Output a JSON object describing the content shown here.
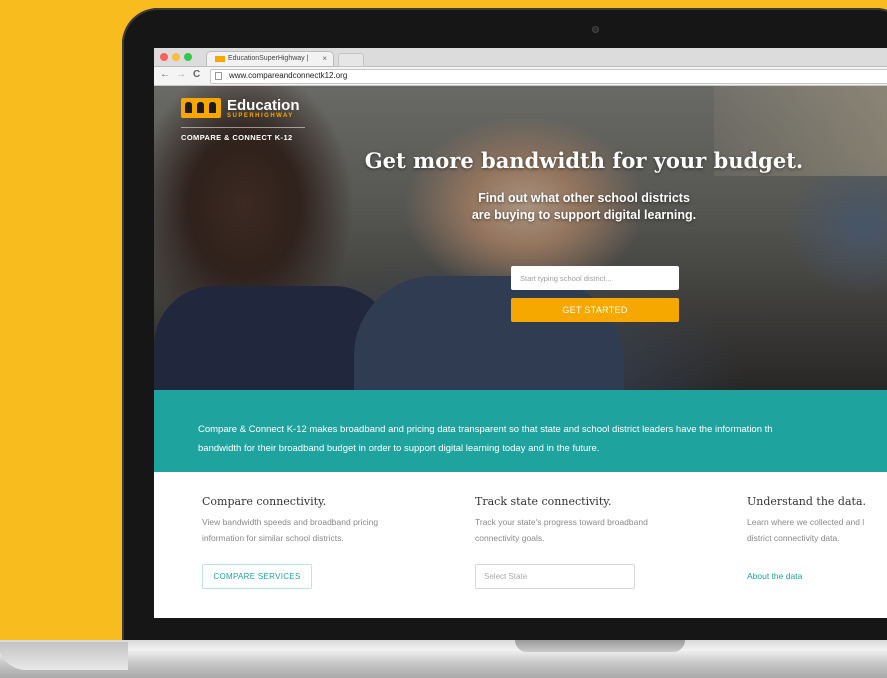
{
  "browser": {
    "tab_title": "EducationSuperHighway |",
    "tab_close": "×",
    "back": "←",
    "forward": "→",
    "reload": "C",
    "url": "www.compareandconnectk12.org"
  },
  "hero": {
    "logo_text": "Education",
    "logo_sub": "SUPERHIGHWAY",
    "product_name": "COMPARE & CONNECT K-12",
    "headline": "Get more bandwidth for your budget.",
    "subhead_line1": "Find out what other school districts",
    "subhead_line2": "are buying to support digital learning.",
    "search_placeholder": "Start typing school district...",
    "cta_label": "GET STARTED"
  },
  "band": {
    "line1": "Compare & Connect K-12 makes broadband and pricing data transparent so that state and school district leaders have the information th",
    "line2": "bandwidth for their broadband budget in order to support digital learning today and in the future."
  },
  "features": [
    {
      "title": "Compare connectivity.",
      "desc_line1": "View bandwidth speeds and broadband pricing",
      "desc_line2": "information for similar school districts.",
      "button_label": "COMPARE SERVICES"
    },
    {
      "title": "Track state connectivity.",
      "desc_line1": "Track your state's progress toward broadband",
      "desc_line2": "connectivity goals.",
      "select_label": "Select State"
    },
    {
      "title": "Understand the data.",
      "desc_line1": "Learn where we collected and l",
      "desc_line2": "district connectivity data.",
      "link_label": "About the data"
    }
  ],
  "colors": {
    "background": "#F8BC1E",
    "accent_yellow": "#F6A800",
    "teal": "#1FA39E"
  }
}
